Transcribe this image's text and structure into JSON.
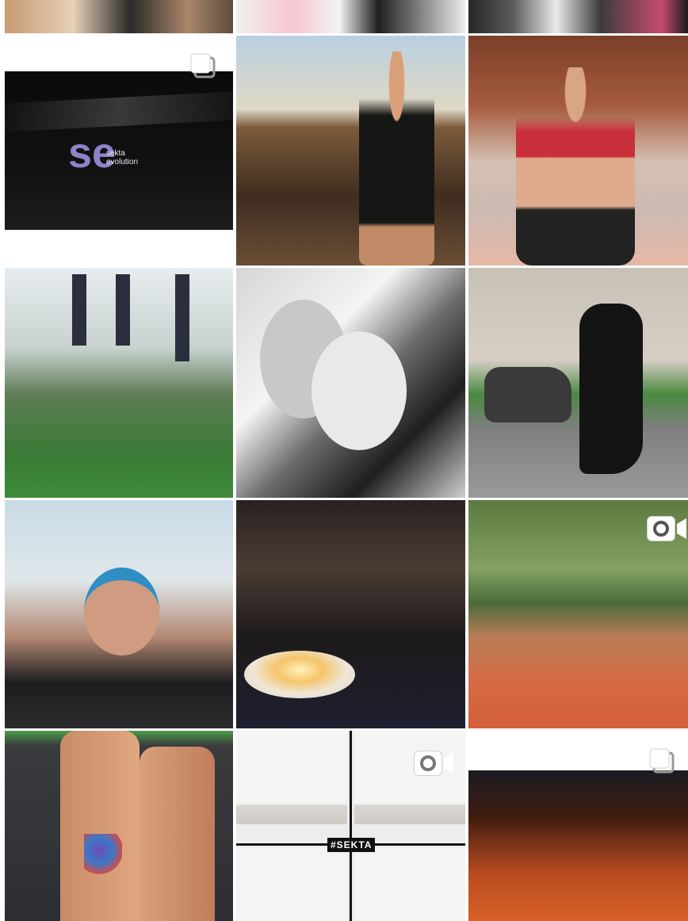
{
  "feed": {
    "tiles": [
      {
        "id": "partial-1",
        "type": "photo"
      },
      {
        "id": "partial-2",
        "type": "photo"
      },
      {
        "id": "partial-3",
        "type": "photo"
      },
      {
        "id": "sekta-logo",
        "type": "carousel",
        "logo_mark": "se",
        "brand_line1": "sekta",
        "brand_line2": "evolution"
      },
      {
        "id": "girl-rooftop",
        "type": "photo"
      },
      {
        "id": "yoga-class",
        "type": "photo"
      },
      {
        "id": "cycling-event",
        "type": "photo"
      },
      {
        "id": "mother-child",
        "type": "photo"
      },
      {
        "id": "scooter-woman",
        "type": "photo"
      },
      {
        "id": "swimmer",
        "type": "photo"
      },
      {
        "id": "birthday-cake",
        "type": "photo"
      },
      {
        "id": "outdoor-workout",
        "type": "video"
      },
      {
        "id": "tattoo-legs",
        "type": "photo"
      },
      {
        "id": "exercise-collage",
        "type": "video",
        "hashtag": "#SEKTA"
      },
      {
        "id": "concert-crowd",
        "type": "carousel"
      }
    ],
    "icons": {
      "carousel": "carousel-icon",
      "video": "video-camera-icon"
    },
    "colors": {
      "background": "#ffffff",
      "logo_accent": "#8f82c9",
      "icon_white": "#ffffff"
    }
  }
}
